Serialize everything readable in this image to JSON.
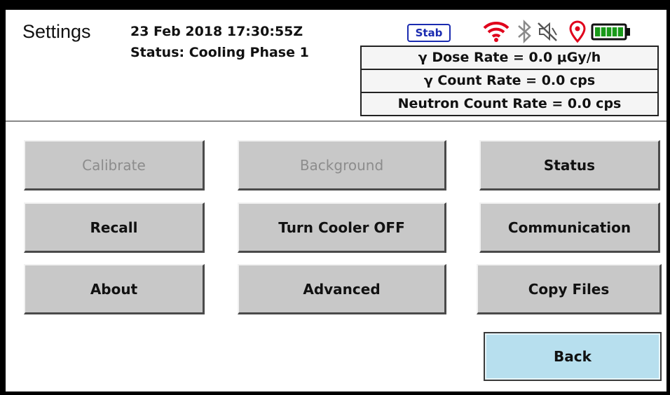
{
  "header": {
    "title": "Settings",
    "datetime": "23 Feb 2018 17:30:55Z",
    "status": "Status: Cooling Phase 1",
    "stab_badge": "Stab"
  },
  "status_icons": [
    "wifi-icon",
    "bluetooth-icon",
    "muted-speaker-icon",
    "location-pin-icon",
    "battery-icon"
  ],
  "colors": {
    "wifi": "#e0001b",
    "location": "#e0001b",
    "battery": "#1a9a1a",
    "stab": "#1a2bb0",
    "back_button": "#b7dfee"
  },
  "readouts": {
    "dose_rate": "γ Dose Rate = 0.0  μGy/h",
    "count_rate": "γ Count Rate = 0.0 cps",
    "neutron_rate": "Neutron Count Rate = 0.0 cps"
  },
  "buttons": {
    "calibrate": "Calibrate",
    "background": "Background",
    "status": "Status",
    "recall": "Recall",
    "turn_cooler_off": "Turn Cooler OFF",
    "communication": "Communication",
    "about": "About",
    "advanced": "Advanced",
    "copy_files": "Copy Files",
    "back": "Back"
  }
}
